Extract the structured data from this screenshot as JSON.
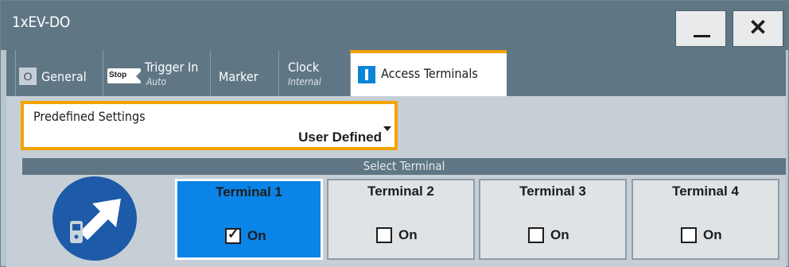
{
  "window": {
    "title": "1xEV-DO"
  },
  "tabs": [
    {
      "label": "General",
      "indicator": "O"
    },
    {
      "label": "Trigger In",
      "icon_text": "Stop",
      "sub": "Auto"
    },
    {
      "label": "Marker"
    },
    {
      "label": "Clock",
      "sub": "Internal"
    },
    {
      "label": "Access Terminals",
      "active": true
    }
  ],
  "predefined": {
    "label": "Predefined Settings",
    "value": "User Defined"
  },
  "select_terminal": {
    "header": "Select Terminal",
    "terminals": [
      {
        "name": "Terminal 1",
        "state_label": "On",
        "checked": true,
        "selected": true
      },
      {
        "name": "Terminal 2",
        "state_label": "On",
        "checked": false
      },
      {
        "name": "Terminal 3",
        "state_label": "On",
        "checked": false
      },
      {
        "name": "Terminal 4",
        "state_label": "On",
        "checked": false
      }
    ],
    "icon": "mobile-terminal-icon"
  },
  "colors": {
    "titlebar": "#5f7685",
    "accent": "#f4a300",
    "active_terminal": "#0a84e6",
    "icon_circle": "#1d5aa8"
  }
}
